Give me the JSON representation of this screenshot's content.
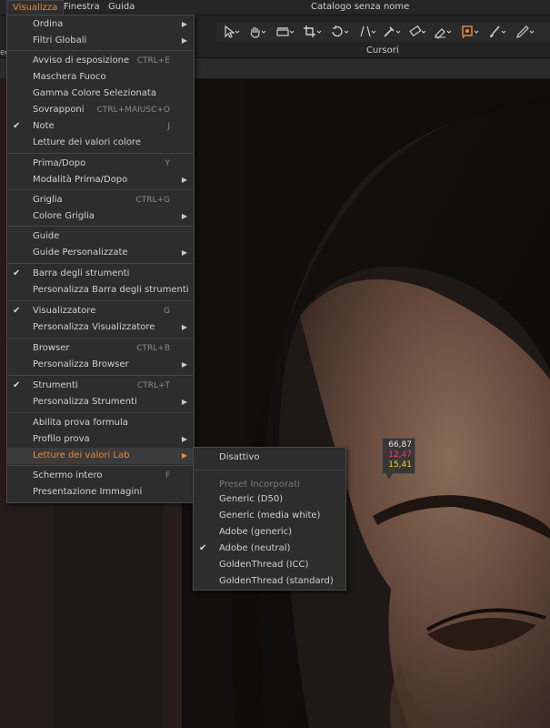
{
  "menubar": {
    "items": [
      "Visualizza",
      "Finestra",
      "Guida"
    ],
    "window_title": "Catalogo senza nome"
  },
  "toolbar": {
    "cursors_label": "Cursori",
    "left_stub": "eg",
    "tools": [
      "select-arrow-icon",
      "hand-pan-icon",
      "straighten-icon",
      "crop-icon",
      "rotate-icon",
      "keystone-icon",
      "color-picker-icon",
      "wb-picker-icon",
      "eraser-brush-icon",
      "color-readout-icon",
      "brush-icon",
      "pencil-icon"
    ]
  },
  "main_menu": {
    "items": [
      {
        "label": "Ordina",
        "submenu": true
      },
      {
        "label": "Filtri Globali",
        "submenu": true
      },
      {
        "label": "Avviso di esposizione",
        "shortcut": "CTRL+E"
      },
      {
        "label": "Maschera Fuoco"
      },
      {
        "label": "Gamma Colore Selezionata"
      },
      {
        "label": "Sovrapponi",
        "shortcut": "CTRL+MAIUSC+O"
      },
      {
        "label": "Note",
        "shortcut": "J",
        "checked": true
      },
      {
        "label": "Letture dei valori colore"
      },
      {
        "label": "Prima/Dopo",
        "shortcut": "Y"
      },
      {
        "label": "Modalità Prima/Dopo",
        "submenu": true
      },
      {
        "label": "Griglia",
        "shortcut": "CTRL+G"
      },
      {
        "label": "Colore Griglia",
        "submenu": true
      },
      {
        "label": "Guide"
      },
      {
        "label": "Guide Personalizzate",
        "submenu": true
      },
      {
        "label": "Barra degli strumenti",
        "checked": true
      },
      {
        "label": "Personalizza Barra degli strumenti"
      },
      {
        "label": "Visualizzatore",
        "shortcut": "G",
        "checked": true
      },
      {
        "label": "Personalizza Visualizzatore",
        "submenu": true
      },
      {
        "label": "Browser",
        "shortcut": "CTRL+B"
      },
      {
        "label": "Personalizza Browser",
        "submenu": true
      },
      {
        "label": "Strumenti",
        "shortcut": "CTRL+T",
        "checked": true
      },
      {
        "label": "Personalizza Strumenti",
        "submenu": true
      },
      {
        "label": "Abilita prova formula"
      },
      {
        "label": "Profilo prova",
        "submenu": true
      },
      {
        "label": "Letture dei valori Lab",
        "submenu": true,
        "highlighted": true
      },
      {
        "label": "Schermo intero",
        "shortcut": "F"
      },
      {
        "label": "Presentazione Immagini"
      }
    ]
  },
  "sub_menu": {
    "items": [
      {
        "label": "Disattivo"
      },
      {
        "label": "Preset Incorporati",
        "muted": true
      },
      {
        "label": "Generic (D50)"
      },
      {
        "label": "Generic (media white)"
      },
      {
        "label": "Adobe (generic)"
      },
      {
        "label": "Adobe (neutral)",
        "checked": true
      },
      {
        "label": "GoldenThread (ICC)"
      },
      {
        "label": "GoldenThread (standard)"
      }
    ]
  },
  "lab_readout": {
    "L": "66,87",
    "a": "12,47",
    "b": "15,41"
  },
  "colors": {
    "accent": "#e8883a",
    "menu_bg": "#2d2d2d",
    "lab_a": "#ef3d77",
    "lab_b": "#f1d43b"
  },
  "check_glyph": "✔",
  "arrow_glyph": "▶"
}
